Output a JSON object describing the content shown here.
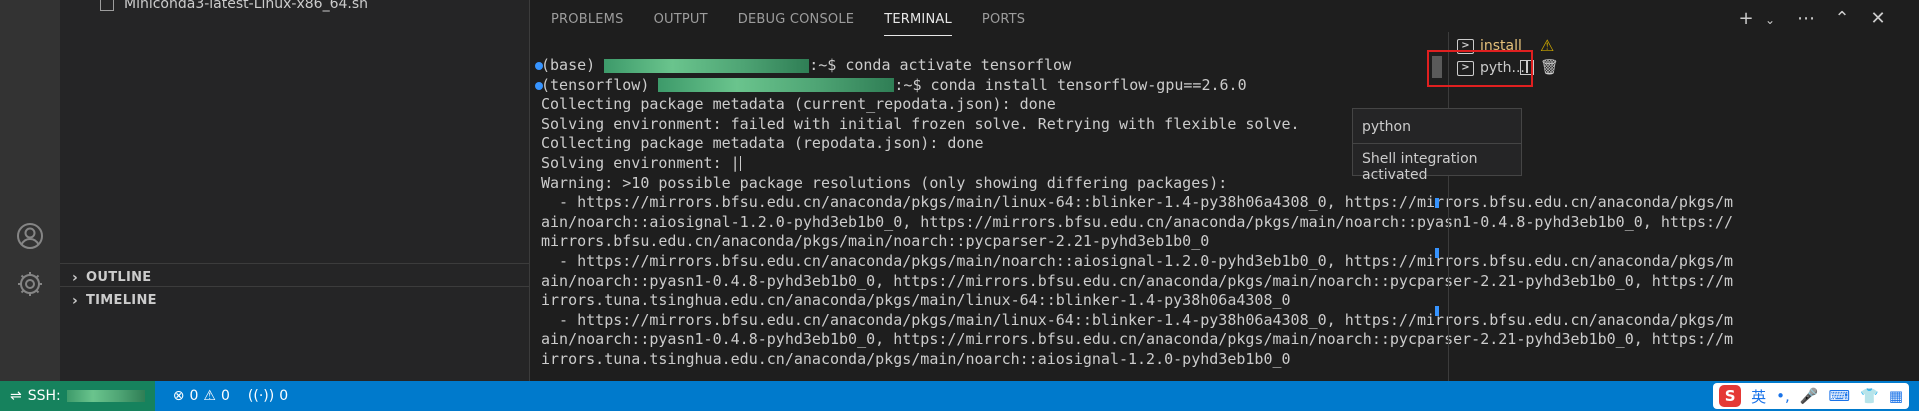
{
  "sidebar": {
    "top_file": "Miniconda3-latest-Linux-x86_64.sh",
    "outline_label": "OUTLINE",
    "timeline_label": "TIMELINE"
  },
  "panel": {
    "tabs": [
      "PROBLEMS",
      "OUTPUT",
      "DEBUG CONSOLE",
      "TERMINAL",
      "PORTS"
    ],
    "active_tab": "TERMINAL",
    "actions": [
      "plus-icon",
      "chevron-down-icon",
      "more-icon",
      "chevron-up-icon",
      "close-icon"
    ]
  },
  "terminal": {
    "lines": [
      {
        "prefix": "(base) ",
        "redacted": true,
        "suffix": ":~$ conda activate tensorflow",
        "marker": true
      },
      {
        "prefix": "(tensorflow) ",
        "redacted": true,
        "suffix": ":~$ conda install tensorflow-gpu==2.6.0",
        "marker": true
      },
      {
        "text": "Collecting package metadata (current_repodata.json): done"
      },
      {
        "text": "Solving environment: failed with initial frozen solve. Retrying with flexible solve."
      },
      {
        "text": "Collecting package metadata (repodata.json): done"
      },
      {
        "text": "Solving environment: |",
        "cursor": true
      },
      {
        "text": "Warning: >10 possible package resolutions (only showing differing packages):"
      },
      {
        "text": "  - https://mirrors.bfsu.edu.cn/anaconda/pkgs/main/linux-64::blinker-1.4-py38h06a4308_0, https://mirrors.bfsu.edu.cn/anaconda/pkgs/m"
      },
      {
        "text": "ain/noarch::aiosignal-1.2.0-pyhd3eb1b0_0, https://mirrors.bfsu.edu.cn/anaconda/pkgs/main/noarch::pyasn1-0.4.8-pyhd3eb1b0_0, https://"
      },
      {
        "text": "mirrors.bfsu.edu.cn/anaconda/pkgs/main/noarch::pycparser-2.21-pyhd3eb1b0_0"
      },
      {
        "text": "  - https://mirrors.bfsu.edu.cn/anaconda/pkgs/main/noarch::aiosignal-1.2.0-pyhd3eb1b0_0, https://mirrors.bfsu.edu.cn/anaconda/pkgs/m"
      },
      {
        "text": "ain/noarch::pyasn1-0.4.8-pyhd3eb1b0_0, https://mirrors.bfsu.edu.cn/anaconda/pkgs/main/noarch::pycparser-2.21-pyhd3eb1b0_0, https://m"
      },
      {
        "text": "irrors.tuna.tsinghua.edu.cn/anaconda/pkgs/main/linux-64::blinker-1.4-py38h06a4308_0"
      },
      {
        "text": "  - https://mirrors.bfsu.edu.cn/anaconda/pkgs/main/linux-64::blinker-1.4-py38h06a4308_0, https://mirrors.bfsu.edu.cn/anaconda/pkgs/m"
      },
      {
        "text": "ain/noarch::pyasn1-0.4.8-pyhd3eb1b0_0, https://mirrors.bfsu.edu.cn/anaconda/pkgs/main/noarch::pycparser-2.21-pyhd3eb1b0_0, https://m"
      },
      {
        "text": "irrors.tuna.tsinghua.edu.cn/anaconda/pkgs/main/noarch::aiosignal-1.2.0-pyhd3eb1b0_0"
      }
    ]
  },
  "terminal_list": {
    "items": [
      {
        "label": "install",
        "icon": "terminal-icon"
      },
      {
        "label": "pyth...",
        "icon": "terminal-icon"
      }
    ]
  },
  "hover": {
    "title": "python",
    "detail": "Shell integration activated"
  },
  "status_bar": {
    "remote_label": "SSH:",
    "errors": "0",
    "warnings": "0",
    "ports": "0",
    "ime_label": "英"
  },
  "colors": {
    "accent": "#007acc",
    "remote_bg": "#16825d",
    "highlight": "#e02020",
    "warning": "#cca700"
  }
}
